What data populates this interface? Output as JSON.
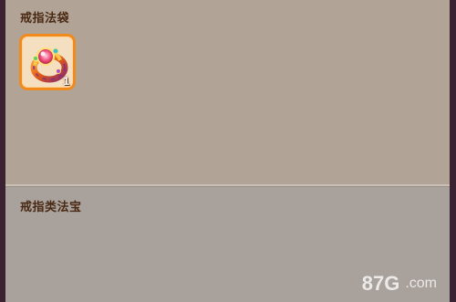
{
  "bag_section": {
    "title": "戒指法袋",
    "items": [
      {
        "icon": "ring-icon",
        "count": "1",
        "border_color": "#f08a1c"
      }
    ]
  },
  "category_section": {
    "title": "戒指类法宝"
  },
  "watermark": {
    "brand": "87G",
    "suffix": ".com"
  },
  "colors": {
    "panel_top": "#b1a396",
    "panel_bottom": "#a9a19b",
    "title_text": "#4a2a14",
    "frame": "#3b2232"
  }
}
